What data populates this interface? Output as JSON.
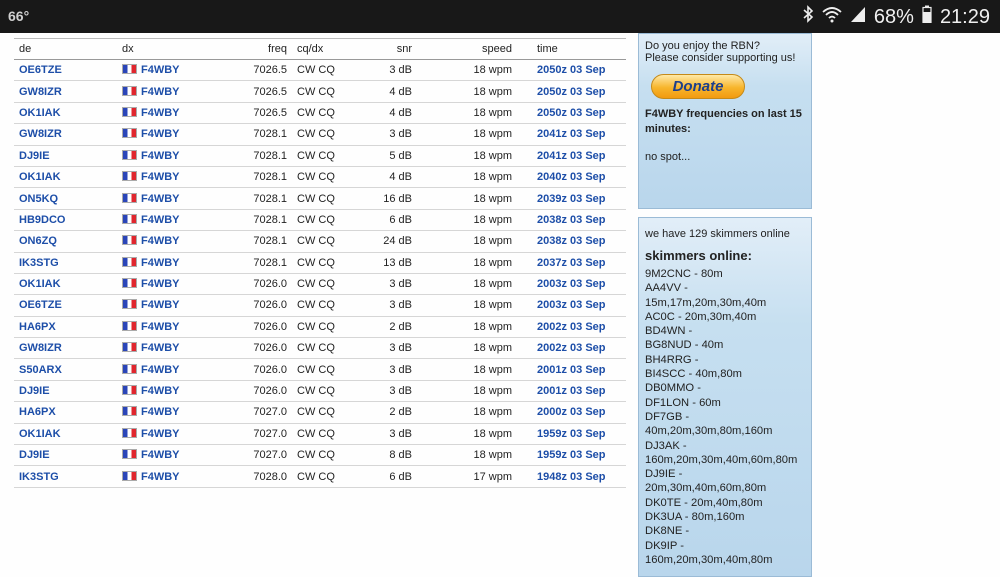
{
  "status": {
    "left": "66°",
    "battery": "68%",
    "time": "21:29"
  },
  "table": {
    "headers": {
      "de": "de",
      "dx": "dx",
      "freq": "freq",
      "cqdx": "cq/dx",
      "snr": "snr",
      "speed": "speed",
      "time": "time"
    },
    "rows": [
      {
        "de": "OE6TZE",
        "dx": "F4WBY",
        "freq": "7026.5",
        "cq": "CW CQ",
        "snr": "3 dB",
        "speed": "18 wpm",
        "time": "2050z 03 Sep"
      },
      {
        "de": "GW8IZR",
        "dx": "F4WBY",
        "freq": "7026.5",
        "cq": "CW CQ",
        "snr": "4 dB",
        "speed": "18 wpm",
        "time": "2050z 03 Sep"
      },
      {
        "de": "OK1IAK",
        "dx": "F4WBY",
        "freq": "7026.5",
        "cq": "CW CQ",
        "snr": "4 dB",
        "speed": "18 wpm",
        "time": "2050z 03 Sep"
      },
      {
        "de": "GW8IZR",
        "dx": "F4WBY",
        "freq": "7028.1",
        "cq": "CW CQ",
        "snr": "3 dB",
        "speed": "18 wpm",
        "time": "2041z 03 Sep"
      },
      {
        "de": "DJ9IE",
        "dx": "F4WBY",
        "freq": "7028.1",
        "cq": "CW CQ",
        "snr": "5 dB",
        "speed": "18 wpm",
        "time": "2041z 03 Sep"
      },
      {
        "de": "OK1IAK",
        "dx": "F4WBY",
        "freq": "7028.1",
        "cq": "CW CQ",
        "snr": "4 dB",
        "speed": "18 wpm",
        "time": "2040z 03 Sep"
      },
      {
        "de": "ON5KQ",
        "dx": "F4WBY",
        "freq": "7028.1",
        "cq": "CW CQ",
        "snr": "16 dB",
        "speed": "18 wpm",
        "time": "2039z 03 Sep"
      },
      {
        "de": "HB9DCO",
        "dx": "F4WBY",
        "freq": "7028.1",
        "cq": "CW CQ",
        "snr": "6 dB",
        "speed": "18 wpm",
        "time": "2038z 03 Sep"
      },
      {
        "de": "ON6ZQ",
        "dx": "F4WBY",
        "freq": "7028.1",
        "cq": "CW CQ",
        "snr": "24 dB",
        "speed": "18 wpm",
        "time": "2038z 03 Sep"
      },
      {
        "de": "IK3STG",
        "dx": "F4WBY",
        "freq": "7028.1",
        "cq": "CW CQ",
        "snr": "13 dB",
        "speed": "18 wpm",
        "time": "2037z 03 Sep"
      },
      {
        "de": "OK1IAK",
        "dx": "F4WBY",
        "freq": "7026.0",
        "cq": "CW CQ",
        "snr": "3 dB",
        "speed": "18 wpm",
        "time": "2003z 03 Sep"
      },
      {
        "de": "OE6TZE",
        "dx": "F4WBY",
        "freq": "7026.0",
        "cq": "CW CQ",
        "snr": "3 dB",
        "speed": "18 wpm",
        "time": "2003z 03 Sep"
      },
      {
        "de": "HA6PX",
        "dx": "F4WBY",
        "freq": "7026.0",
        "cq": "CW CQ",
        "snr": "2 dB",
        "speed": "18 wpm",
        "time": "2002z 03 Sep"
      },
      {
        "de": "GW8IZR",
        "dx": "F4WBY",
        "freq": "7026.0",
        "cq": "CW CQ",
        "snr": "3 dB",
        "speed": "18 wpm",
        "time": "2002z 03 Sep"
      },
      {
        "de": "S50ARX",
        "dx": "F4WBY",
        "freq": "7026.0",
        "cq": "CW CQ",
        "snr": "3 dB",
        "speed": "18 wpm",
        "time": "2001z 03 Sep"
      },
      {
        "de": "DJ9IE",
        "dx": "F4WBY",
        "freq": "7026.0",
        "cq": "CW CQ",
        "snr": "3 dB",
        "speed": "18 wpm",
        "time": "2001z 03 Sep"
      },
      {
        "de": "HA6PX",
        "dx": "F4WBY",
        "freq": "7027.0",
        "cq": "CW CQ",
        "snr": "2 dB",
        "speed": "18 wpm",
        "time": "2000z 03 Sep"
      },
      {
        "de": "OK1IAK",
        "dx": "F4WBY",
        "freq": "7027.0",
        "cq": "CW CQ",
        "snr": "3 dB",
        "speed": "18 wpm",
        "time": "1959z 03 Sep"
      },
      {
        "de": "DJ9IE",
        "dx": "F4WBY",
        "freq": "7027.0",
        "cq": "CW CQ",
        "snr": "8 dB",
        "speed": "18 wpm",
        "time": "1959z 03 Sep"
      },
      {
        "de": "IK3STG",
        "dx": "F4WBY",
        "freq": "7028.0",
        "cq": "CW CQ",
        "snr": "6 dB",
        "speed": "17 wpm",
        "time": "1948z 03 Sep"
      }
    ]
  },
  "support": {
    "line1": "Do you enjoy the RBN?",
    "line2": "Please consider supporting us!",
    "donate_label": "Donate",
    "freq_heading": "F4WBY frequencies on last 15 minutes:",
    "no_spot": "no spot..."
  },
  "skimmers": {
    "count_text": "we have 129 skimmers online",
    "heading": "skimmers online:",
    "list": [
      "9M2CNC - 80m",
      "AA4VV -",
      "15m,17m,20m,30m,40m",
      "AC0C - 20m,30m,40m",
      "BD4WN -",
      "BG8NUD - 40m",
      "BH4RRG -",
      "BI4SCC - 40m,80m",
      "DB0MMO -",
      "DF1LON - 60m",
      "DF7GB -",
      "40m,20m,30m,80m,160m",
      "DJ3AK -",
      "160m,20m,30m,40m,60m,80m",
      "DJ9IE - 20m,30m,40m,60m,80m",
      "DK0TE - 20m,40m,80m",
      "DK3UA - 80m,160m",
      "DK8NE -",
      "DK9IP -",
      "160m,20m,30m,40m,80m"
    ]
  }
}
